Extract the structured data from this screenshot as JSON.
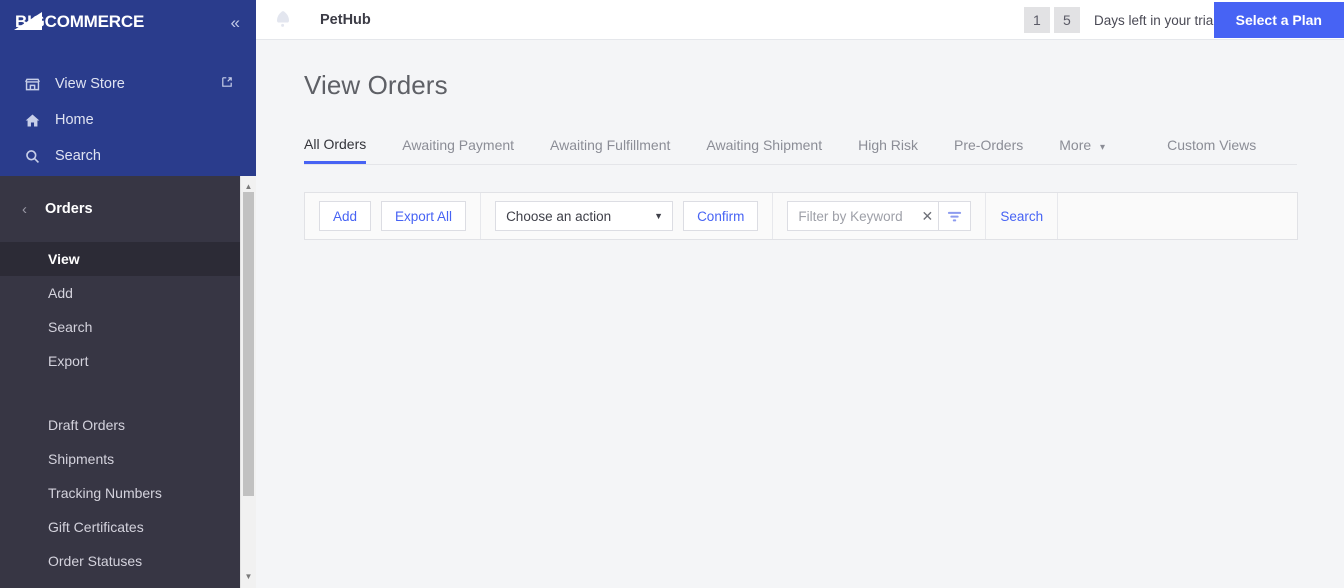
{
  "sidebar": {
    "brand": "BIGCOMMERCE",
    "collapse_icon": "double-chevron-left-icon",
    "top_items": [
      {
        "label": "View Store",
        "icon": "store-icon",
        "external_icon": "external-link-icon"
      },
      {
        "label": "Home",
        "icon": "home-icon"
      },
      {
        "label": "Search",
        "icon": "search-icon"
      }
    ],
    "section": {
      "title": "Orders",
      "back_icon": "chevron-left-icon",
      "items": [
        {
          "label": "View",
          "active": true
        },
        {
          "label": "Add",
          "active": false
        },
        {
          "label": "Search",
          "active": false
        },
        {
          "label": "Export",
          "active": false
        }
      ],
      "items2": [
        {
          "label": "Draft Orders"
        },
        {
          "label": "Shipments"
        },
        {
          "label": "Tracking Numbers"
        },
        {
          "label": "Gift Certificates"
        },
        {
          "label": "Order Statuses"
        }
      ]
    },
    "scrollbar": {
      "up_icon": "scroll-up-arrow-icon",
      "down_icon": "scroll-down-arrow-icon"
    }
  },
  "topbar": {
    "store_icon": "store-flag-icon",
    "store_name": "PetHub",
    "trial_digits": [
      "1",
      "5"
    ],
    "trial_text": "Days left in your trial.",
    "plan_button": "Select a Plan"
  },
  "page": {
    "title": "View Orders"
  },
  "tabs": [
    {
      "label": "All Orders",
      "active": true
    },
    {
      "label": "Awaiting Payment",
      "active": false
    },
    {
      "label": "Awaiting Fulfillment",
      "active": false
    },
    {
      "label": "Awaiting Shipment",
      "active": false
    },
    {
      "label": "High Risk",
      "active": false
    },
    {
      "label": "Pre-Orders",
      "active": false
    },
    {
      "label": "More",
      "active": false,
      "caret": "chevron-down-icon"
    },
    {
      "label": "Custom Views",
      "active": false
    }
  ],
  "toolbar": {
    "add_label": "Add",
    "export_label": "Export All",
    "action_select_value": "Choose an action",
    "action_select_caret": "caret-down-icon",
    "confirm_label": "Confirm",
    "filter_placeholder": "Filter by Keyword",
    "filter_value": "",
    "clear_icon": "close-x-icon",
    "filter_icon": "filter-icon",
    "search_label": "Search"
  },
  "colors": {
    "brand_blue": "#2a3c8c",
    "accent": "#4763f4",
    "sidebar_dark": "#373644",
    "sidebar_active": "#2c2b36",
    "page_bg": "#f4f5f7"
  }
}
